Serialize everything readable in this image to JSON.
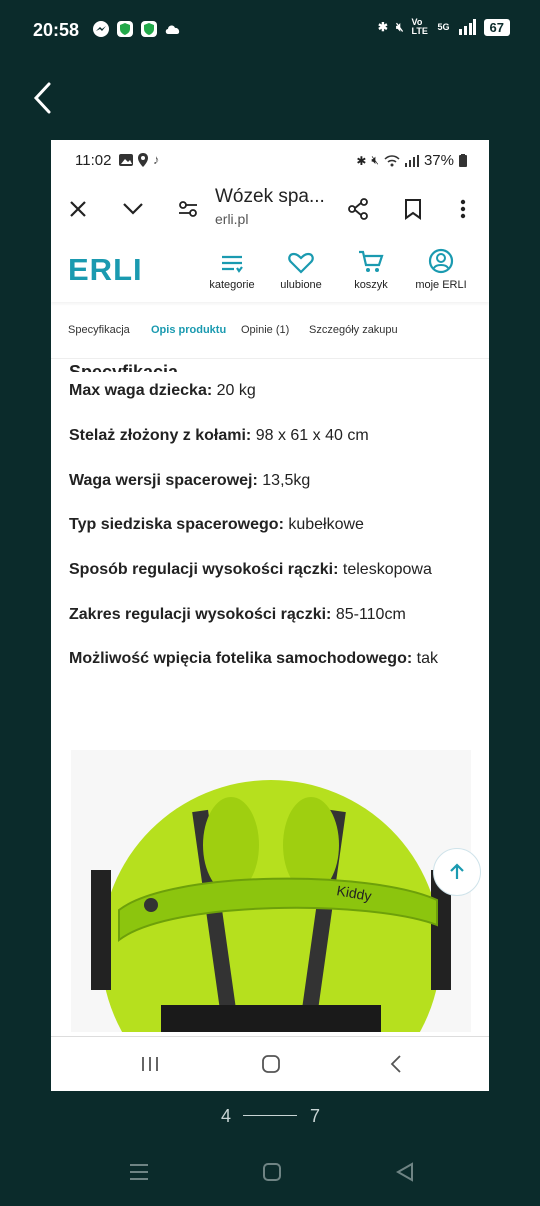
{
  "outer_status": {
    "time": "20:58",
    "signal_label": "Vo LTE",
    "network": "5G",
    "battery": "67"
  },
  "inner_status": {
    "time": "11:02",
    "battery": "37%"
  },
  "browser": {
    "title": "Wózek spa...",
    "url": "erli.pl"
  },
  "site": {
    "logo": "ERLI",
    "nav": [
      {
        "label": "kategorie",
        "icon": "list-icon"
      },
      {
        "label": "ulubione",
        "icon": "heart-icon"
      },
      {
        "label": "koszyk",
        "icon": "cart-icon"
      },
      {
        "label": "moje ERLI",
        "icon": "user-icon"
      }
    ],
    "accent": "#1a9ab0"
  },
  "tabs": [
    {
      "label": "Specyfikacja",
      "active": false
    },
    {
      "label": "Opis produktu",
      "active": true
    },
    {
      "label": "Opinie (1)",
      "active": false
    },
    {
      "label": "Szczegóły zakupu",
      "active": false
    }
  ],
  "content": {
    "heading_cut": "Specyfikacja",
    "specs": [
      {
        "label": "Max waga dziecka:",
        "value": "20 kg"
      },
      {
        "label": "Stelaż złożony z kołami:",
        "value": "98 x 61 x 40 cm"
      },
      {
        "label": "Waga wersji spacerowej:",
        "value": "13,5kg"
      },
      {
        "label": "Typ siedziska spacerowego:",
        "value": "kubełkowe"
      },
      {
        "label": "Sposób regulacji wysokości rączki:",
        "value": "teleskopowa"
      },
      {
        "label": "Zakres regulacji wysokości rączki:",
        "value": "85-110cm"
      },
      {
        "label": "Możliwość wpięcia fotelika samochodowego:",
        "value": "tak"
      }
    ],
    "product_image_brand": "Kiddy"
  },
  "pager": {
    "current": "4",
    "total": "7"
  }
}
